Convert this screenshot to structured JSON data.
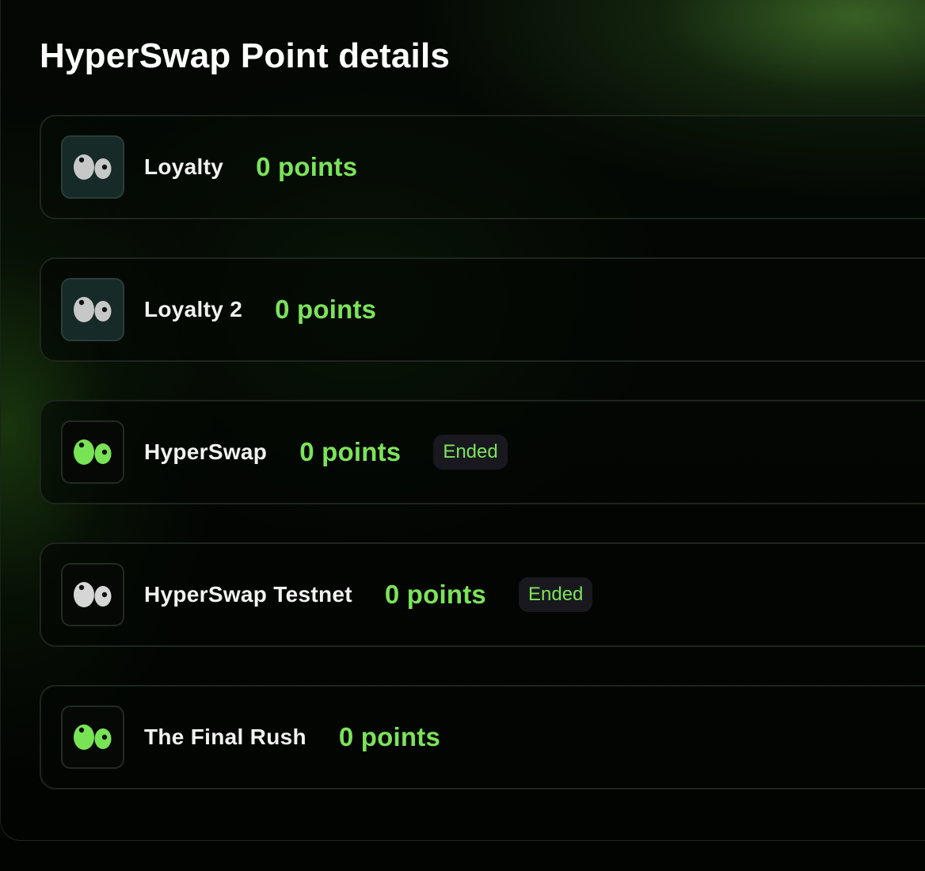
{
  "page": {
    "title": "HyperSwap Point details"
  },
  "programs": [
    {
      "name": "Loyalty",
      "points": "0 points",
      "icon": "eyes-icon-grey",
      "icon_color": "#c5c8c6"
    },
    {
      "name": "Loyalty 2",
      "points": "0 points",
      "icon": "eyes-icon-grey",
      "icon_color": "#c5c8c6"
    },
    {
      "name": "HyperSwap",
      "points": "0 points",
      "status": "Ended",
      "icon": "eyes-icon-green",
      "icon_color": "#79e356"
    },
    {
      "name": "HyperSwap Testnet",
      "points": "0 points",
      "status": "Ended",
      "icon": "eyes-icon-grey",
      "icon_color": "#d6d6d6"
    },
    {
      "name": "The Final Rush",
      "points": "0 points",
      "icon": "eyes-icon-green",
      "icon_color": "#79e356"
    }
  ],
  "colors": {
    "accent_green": "#7ce35a",
    "badge_background": "#18181e",
    "card_border": "#1d251d",
    "background": "#000000"
  }
}
